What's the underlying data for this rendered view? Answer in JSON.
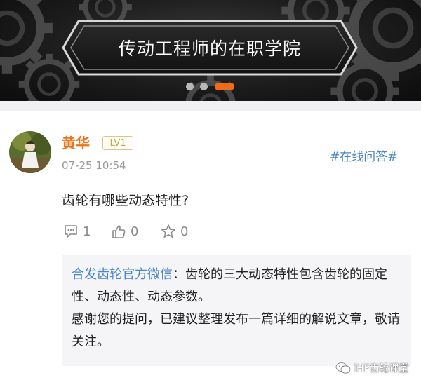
{
  "banner": {
    "title": "传动工程师的在职学院",
    "carousel_dots": 3,
    "active_dot": 3,
    "accent_color": "#f06a1c"
  },
  "post": {
    "username": "黄华",
    "level": "LV1",
    "timestamp": "07-25 10:54",
    "topic": "#在线问答#",
    "question": "齿轮有哪些动态特性?",
    "comment_count": "1",
    "like_count": "0",
    "favorite_count": "0",
    "icons": [
      "comment-icon",
      "thumbs-up-icon",
      "star-icon"
    ],
    "reply": {
      "author": "合发齿轮官方微信",
      "separator": "：",
      "line1": "齿轮的三大动态特性包含齿轮的固定性、动态性、动态参数。",
      "line2": "感谢您的提问，已建议整理发布一篇详细的解说文章，敬请关注。"
    }
  },
  "watermark": {
    "text": "iHF齿轮课堂",
    "icon": "wechat-icon"
  },
  "colors": {
    "username": "#e8741c",
    "link": "#4a86c8",
    "level_badge": "#c9a548"
  }
}
